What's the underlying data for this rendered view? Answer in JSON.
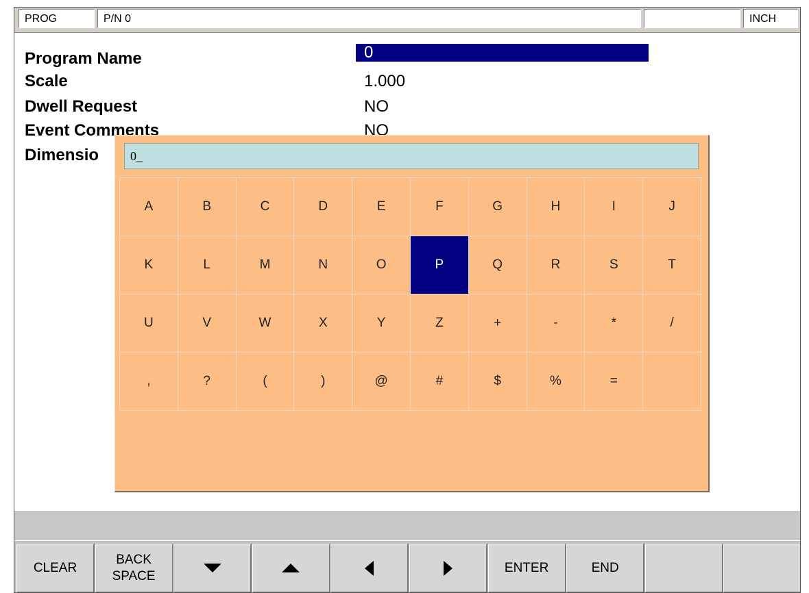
{
  "status_bar": {
    "mode": "PROG",
    "part_number": "P/N 0",
    "blank": "",
    "units": "INCH"
  },
  "fields": [
    {
      "label": "Program Name",
      "value": "0"
    },
    {
      "label": "Scale",
      "value": "1.000"
    },
    {
      "label": "Dwell Request",
      "value": "NO"
    },
    {
      "label": "Event Comments",
      "value": "NO"
    },
    {
      "label": "Dimensio",
      "value": ""
    }
  ],
  "keyboard": {
    "input_value": "0_",
    "keys": [
      [
        "A",
        "B",
        "C",
        "D",
        "E",
        "F",
        "G",
        "H",
        "I",
        "J"
      ],
      [
        "K",
        "L",
        "M",
        "N",
        "O",
        "P",
        "Q",
        "R",
        "S",
        "T"
      ],
      [
        "U",
        "V",
        "W",
        "X",
        "Y",
        "Z",
        "+",
        "-",
        "*",
        "/"
      ],
      [
        ",",
        "?",
        "(",
        ")",
        "@",
        "#",
        "$",
        "%",
        "=",
        ""
      ]
    ],
    "active_key": "P"
  },
  "message": "",
  "softkeys": [
    {
      "label": "CLEAR",
      "icon": ""
    },
    {
      "label": "BACK\nSPACE",
      "icon": ""
    },
    {
      "label": "",
      "icon": "arrow-down-icon"
    },
    {
      "label": "",
      "icon": "arrow-up-icon"
    },
    {
      "label": "",
      "icon": "arrow-left-icon"
    },
    {
      "label": "",
      "icon": "arrow-right-icon"
    },
    {
      "label": "ENTER",
      "icon": ""
    },
    {
      "label": "END",
      "icon": ""
    },
    {
      "label": "",
      "icon": ""
    },
    {
      "label": "",
      "icon": ""
    }
  ],
  "colors": {
    "selection": "#000080",
    "keyboard_bg": "#fdbe85",
    "input_bg": "#bfe0e0",
    "softkey_bg": "#d6d6d6"
  }
}
